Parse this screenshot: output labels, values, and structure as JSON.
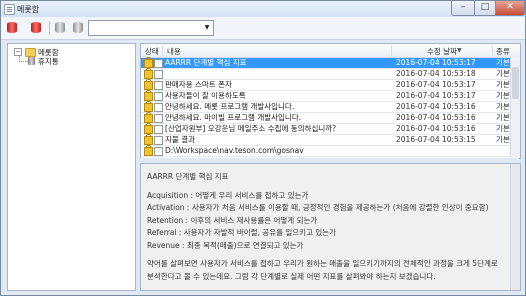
{
  "window": {
    "title": "메롯함"
  },
  "toolbar": {
    "buttons": [
      {
        "icon": "database-red-icon"
      },
      {
        "icon": "database-red-remove-icon"
      },
      {
        "icon": "database-gray-icon"
      },
      {
        "icon": "database-gray-alt-icon"
      }
    ],
    "select_value": ""
  },
  "tree": {
    "root": {
      "label": "메롯함",
      "expanded": true
    },
    "children": [
      {
        "label": "휴지통"
      }
    ]
  },
  "list": {
    "columns": [
      "상태",
      "내용",
      "수정 날짜",
      "종류"
    ],
    "rows": [
      {
        "title": "AARRR 단계별 핵심 지표",
        "date": "2016-07-04 10:53:17",
        "extra": "기본",
        "selected": true
      },
      {
        "title": "",
        "date": "2016-07-04 10:53:18",
        "extra": "기본",
        "selected": false
      },
      {
        "title": "판매자용 스마트 폰자",
        "date": "2016-07-04 10:53:17",
        "extra": "기본",
        "selected": false
      },
      {
        "title": "사용자들이 잘 이용하도록",
        "date": "2016-07-04 10:53:17",
        "extra": "기본",
        "selected": false
      },
      {
        "title": "안녕하세요. 메롯 프로그램 개발사입니다.",
        "date": "2016-07-04 10:53:16",
        "extra": "기본",
        "selected": false
      },
      {
        "title": "안녕하세요. 마이빌 프로그램 개발사입니다.",
        "date": "2016-07-04 10:53:16",
        "extra": "기본",
        "selected": false
      },
      {
        "title": "[산업자원부] 오강운님 메일주소 수집에 동의하십니까?",
        "date": "2016-07-04 10:53:16",
        "extra": "기본",
        "selected": false
      },
      {
        "title": "지불 결과",
        "date": "2016-07-04 10:53:15",
        "extra": "기본",
        "selected": false
      },
      {
        "title": "D:\\Workspace\\nav.teson.com\\gosnav",
        "date": "",
        "extra": "",
        "selected": false
      }
    ]
  },
  "preview": {
    "title": "AARRR 단계별 핵심 지표",
    "lines": [
      "Acquisition : 어떻게 우리 서비스를 접하고 있는가",
      "Activation : 사용자가 처음 서비스를 이용할 때, 긍정적인 경험을 제공하는가 (처음에 강렬한 인상이 중요함)",
      "Retention : 이후의 서비스 재사용률은 어떻게 되는가",
      "Referral : 사용자가 자발적 바이럴, 공유를 일으키고 있는가",
      "Revenue : 최종 목적(매출)으로 연결되고 있는가"
    ],
    "paragraph": "약어를 살펴보면 사용자가 서비스를 접하고 우리가 원하는 매출을 일으키기까지의 전체적인 과정을 크게 5단계로 분석한다고 볼 수 있는데요. 그럼 각 단계별로 실제 어떤 지표를 살펴봐야 하는지 보겠습니다."
  }
}
